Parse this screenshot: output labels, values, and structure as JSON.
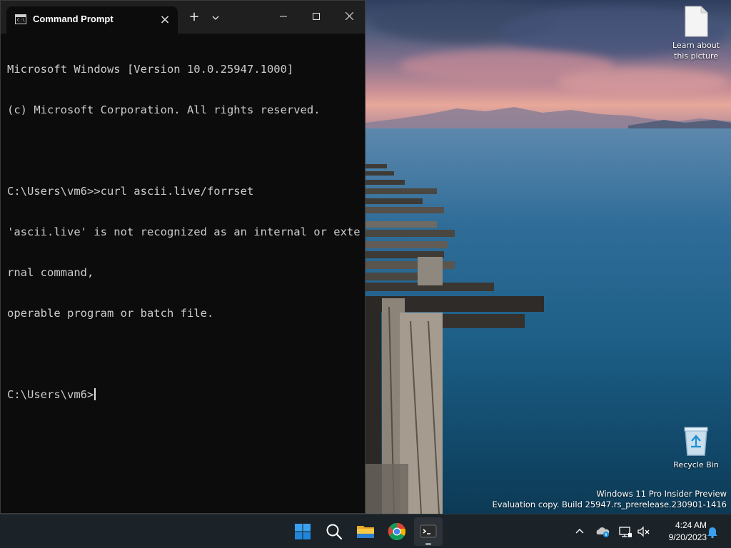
{
  "window": {
    "tab_title": "Command Prompt",
    "new_tab_label": "+",
    "dropdown_label": "⌄",
    "minimize_label": "—",
    "maximize_label": "☐",
    "close_label": "✕",
    "tab_close_label": "×",
    "console_lines": [
      "Microsoft Windows [Version 10.0.25947.1000]",
      "(c) Microsoft Corporation. All rights reserved.",
      "",
      "C:\\Users\\vm6>>curl ascii.live/forrset",
      "'ascii.live' is not recognized as an internal or exte",
      "rnal command,",
      "operable program or batch file.",
      "",
      "C:\\Users\\vm6>"
    ]
  },
  "desktop": {
    "icons": [
      {
        "label": "Learn about this picture",
        "icon": "document-icon"
      },
      {
        "label": "Recycle Bin",
        "icon": "recycle-bin-icon"
      }
    ],
    "watermark_line1": "Windows 11 Pro Insider Preview",
    "watermark_line2": "Evaluation copy. Build 25947.rs_prerelease.230901-1416"
  },
  "taskbar": {
    "apps": [
      {
        "name": "Start",
        "icon": "windows-start-icon"
      },
      {
        "name": "Search",
        "icon": "search-icon"
      },
      {
        "name": "File Explorer",
        "icon": "folder-icon"
      },
      {
        "name": "Google Chrome",
        "icon": "chrome-icon"
      },
      {
        "name": "Terminal",
        "icon": "terminal-icon",
        "active": true
      }
    ],
    "tray": {
      "chevron_label": "^",
      "time": "4:24 AM",
      "date": "9/20/2023"
    }
  },
  "colors": {
    "terminal_bg": "#0c0c0c",
    "terminal_text": "#cccccc",
    "titlebar_bg": "#1f1f1f",
    "taskbar_bg": "#1c2328",
    "accent_blue": "#1a8fe3"
  }
}
